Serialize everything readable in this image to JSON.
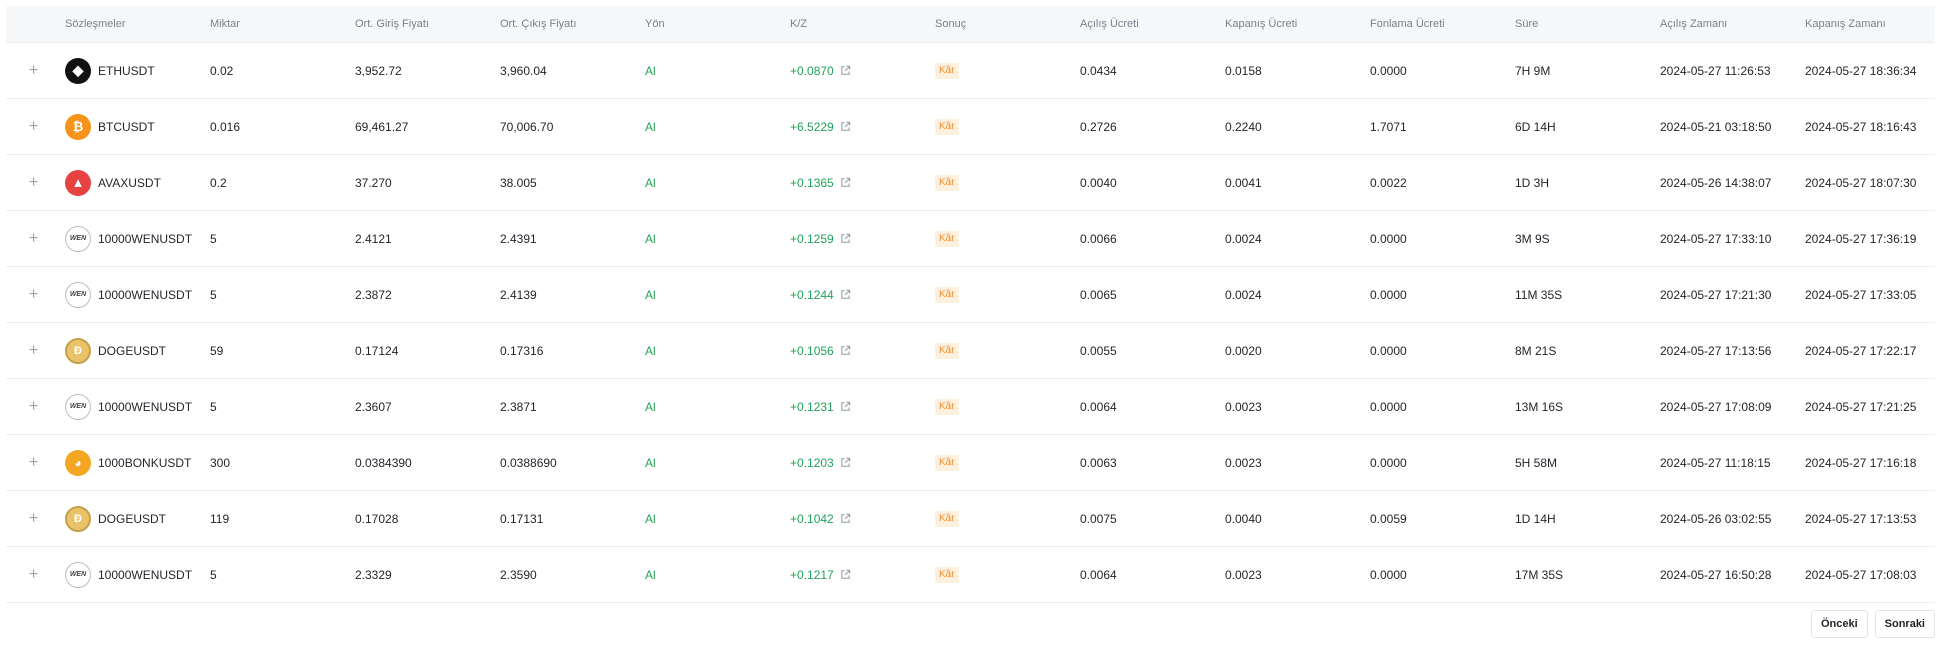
{
  "table": {
    "headers": [
      "Sözleşmeler",
      "Miktar",
      "Ort. Giriş Fiyatı",
      "Ort. Çıkış Fiyatı",
      "Yön",
      "K/Z",
      "Sonuç",
      "Açılış Ücreti",
      "Kapanış Ücreti",
      "Fonlama Ücreti",
      "Süre",
      "Açılış Zamanı",
      "Kapanış Zamanı"
    ],
    "rows": [
      {
        "expand": "+",
        "icon": "eth",
        "contract": "ETHUSDT",
        "qty": "0.02",
        "entry": "3,952.72",
        "exit": "3,960.04",
        "side": "Al",
        "pnl": "+0.0870",
        "result": "Kâr",
        "open_fee": "0.0434",
        "close_fee": "0.0158",
        "funding_fee": "0.0000",
        "duration": "7H 9M",
        "open_time": "2024-05-27 11:26:53",
        "close_time": "2024-05-27 18:36:34"
      },
      {
        "expand": "+",
        "icon": "btc",
        "contract": "BTCUSDT",
        "qty": "0.016",
        "entry": "69,461.27",
        "exit": "70,006.70",
        "side": "Al",
        "pnl": "+6.5229",
        "result": "Kâr",
        "open_fee": "0.2726",
        "close_fee": "0.2240",
        "funding_fee": "1.7071",
        "duration": "6D 14H",
        "open_time": "2024-05-21 03:18:50",
        "close_time": "2024-05-27 18:16:43"
      },
      {
        "expand": "+",
        "icon": "avax",
        "contract": "AVAXUSDT",
        "qty": "0.2",
        "entry": "37.270",
        "exit": "38.005",
        "side": "Al",
        "pnl": "+0.1365",
        "result": "Kâr",
        "open_fee": "0.0040",
        "close_fee": "0.0041",
        "funding_fee": "0.0022",
        "duration": "1D 3H",
        "open_time": "2024-05-26 14:38:07",
        "close_time": "2024-05-27 18:07:30"
      },
      {
        "expand": "+",
        "icon": "wen",
        "contract": "10000WENUSDT",
        "qty": "5",
        "entry": "2.4121",
        "exit": "2.4391",
        "side": "Al",
        "pnl": "+0.1259",
        "result": "Kâr",
        "open_fee": "0.0066",
        "close_fee": "0.0024",
        "funding_fee": "0.0000",
        "duration": "3M 9S",
        "open_time": "2024-05-27 17:33:10",
        "close_time": "2024-05-27 17:36:19"
      },
      {
        "expand": "+",
        "icon": "wen",
        "contract": "10000WENUSDT",
        "qty": "5",
        "entry": "2.3872",
        "exit": "2.4139",
        "side": "Al",
        "pnl": "+0.1244",
        "result": "Kâr",
        "open_fee": "0.0065",
        "close_fee": "0.0024",
        "funding_fee": "0.0000",
        "duration": "11M 35S",
        "open_time": "2024-05-27 17:21:30",
        "close_time": "2024-05-27 17:33:05"
      },
      {
        "expand": "+",
        "icon": "doge",
        "contract": "DOGEUSDT",
        "qty": "59",
        "entry": "0.17124",
        "exit": "0.17316",
        "side": "Al",
        "pnl": "+0.1056",
        "result": "Kâr",
        "open_fee": "0.0055",
        "close_fee": "0.0020",
        "funding_fee": "0.0000",
        "duration": "8M 21S",
        "open_time": "2024-05-27 17:13:56",
        "close_time": "2024-05-27 17:22:17"
      },
      {
        "expand": "+",
        "icon": "wen",
        "contract": "10000WENUSDT",
        "qty": "5",
        "entry": "2.3607",
        "exit": "2.3871",
        "side": "Al",
        "pnl": "+0.1231",
        "result": "Kâr",
        "open_fee": "0.0064",
        "close_fee": "0.0023",
        "funding_fee": "0.0000",
        "duration": "13M 16S",
        "open_time": "2024-05-27 17:08:09",
        "close_time": "2024-05-27 17:21:25"
      },
      {
        "expand": "+",
        "icon": "bonk",
        "contract": "1000BONKUSDT",
        "qty": "300",
        "entry": "0.0384390",
        "exit": "0.0388690",
        "side": "Al",
        "pnl": "+0.1203",
        "result": "Kâr",
        "open_fee": "0.0063",
        "close_fee": "0.0023",
        "funding_fee": "0.0000",
        "duration": "5H 58M",
        "open_time": "2024-05-27 11:18:15",
        "close_time": "2024-05-27 17:16:18"
      },
      {
        "expand": "+",
        "icon": "doge",
        "contract": "DOGEUSDT",
        "qty": "119",
        "entry": "0.17028",
        "exit": "0.17131",
        "side": "Al",
        "pnl": "+0.1042",
        "result": "Kâr",
        "open_fee": "0.0075",
        "close_fee": "0.0040",
        "funding_fee": "0.0059",
        "duration": "1D 14H",
        "open_time": "2024-05-26 03:02:55",
        "close_time": "2024-05-27 17:13:53"
      },
      {
        "expand": "+",
        "icon": "wen",
        "contract": "10000WENUSDT",
        "qty": "5",
        "entry": "2.3329",
        "exit": "2.3590",
        "side": "Al",
        "pnl": "+0.1217",
        "result": "Kâr",
        "open_fee": "0.0064",
        "close_fee": "0.0023",
        "funding_fee": "0.0000",
        "duration": "17M 35S",
        "open_time": "2024-05-27 16:50:28",
        "close_time": "2024-05-27 17:08:03"
      }
    ]
  },
  "icons": {
    "eth": {
      "glyph": "◆",
      "name": "ethereum-coin-icon"
    },
    "btc": {
      "glyph": "₿",
      "name": "bitcoin-coin-icon"
    },
    "avax": {
      "glyph": "▲",
      "name": "avalanche-coin-icon"
    },
    "wen": {
      "glyph": "WEN",
      "name": "wen-coin-icon"
    },
    "doge": {
      "glyph": "Ð",
      "name": "dogecoin-coin-icon"
    },
    "bonk": {
      "glyph": "◕",
      "name": "bonk-coin-icon"
    }
  },
  "pagination": {
    "prev": "Önceki",
    "next": "Sonraki"
  },
  "colors": {
    "positive": "#22a15b",
    "profit_badge_text": "#e8912d",
    "profit_badge_bg": "#fdf0dd",
    "header_bg": "#f6f7f9"
  }
}
